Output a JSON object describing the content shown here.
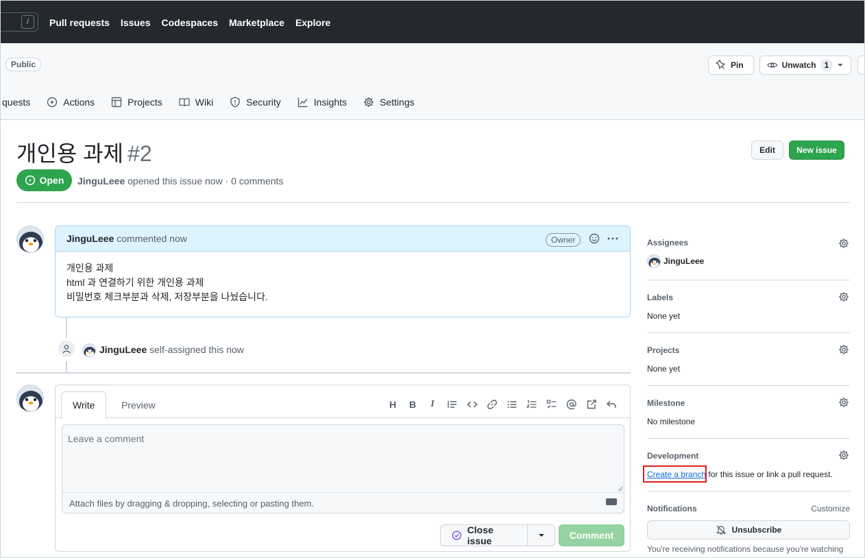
{
  "topnav": {
    "slash_hint": "/",
    "links": [
      "Pull requests",
      "Issues",
      "Codespaces",
      "Marketplace",
      "Explore"
    ]
  },
  "repo": {
    "visibility": "Public",
    "pin_label": "Pin",
    "unwatch_label": "Unwatch",
    "watch_count": "1",
    "tabs": [
      "quests",
      "Actions",
      "Projects",
      "Wiki",
      "Security",
      "Insights",
      "Settings"
    ]
  },
  "issue": {
    "title": "개인용 과제",
    "number": "#2",
    "edit_label": "Edit",
    "new_issue_label": "New issue",
    "state": "Open",
    "author": "JinguLeee",
    "meta_text": "opened this issue now · 0 comments"
  },
  "comment": {
    "author": "JinguLeee",
    "action": "commented now",
    "role_badge": "Owner",
    "lines": [
      "개인용 과제",
      "html 과 연결하기 위한 개인용 과제",
      "비밀번호 체크부분과 삭제, 저장부분을 나눴습니다."
    ]
  },
  "event": {
    "actor": "JinguLeee",
    "text": "self-assigned this now"
  },
  "composer": {
    "write_tab": "Write",
    "preview_tab": "Preview",
    "placeholder": "Leave a comment",
    "attach_hint": "Attach files by dragging & dropping, selecting or pasting them.",
    "toolbar_icons": [
      "heading-icon",
      "bold-icon",
      "italic-icon",
      "quote-icon",
      "code-icon",
      "link-icon",
      "unordered-list-icon",
      "ordered-list-icon",
      "task-list-icon",
      "mention-icon",
      "reference-icon",
      "reply-icon"
    ],
    "close_issue_label": "Close issue",
    "comment_label": "Comment"
  },
  "sidebar": {
    "assignees": {
      "title": "Assignees",
      "value": "JinguLeee"
    },
    "labels": {
      "title": "Labels",
      "value": "None yet"
    },
    "projects": {
      "title": "Projects",
      "value": "None yet"
    },
    "milestone": {
      "title": "Milestone",
      "value": "No milestone"
    },
    "development": {
      "title": "Development",
      "link_text": "Create a branch",
      "rest_text": "for this issue or link a pull request."
    },
    "notifications": {
      "title": "Notifications",
      "customize": "Customize",
      "unsubscribe_label": "Unsubscribe",
      "note": "You're receiving notifications because you're watching"
    }
  },
  "colors": {
    "header_bg": "#24292f",
    "open_green": "#2da44e",
    "link_blue": "#0969da",
    "highlight_red": "#e01e1e",
    "comment_header_bg": "#ddf4ff"
  }
}
